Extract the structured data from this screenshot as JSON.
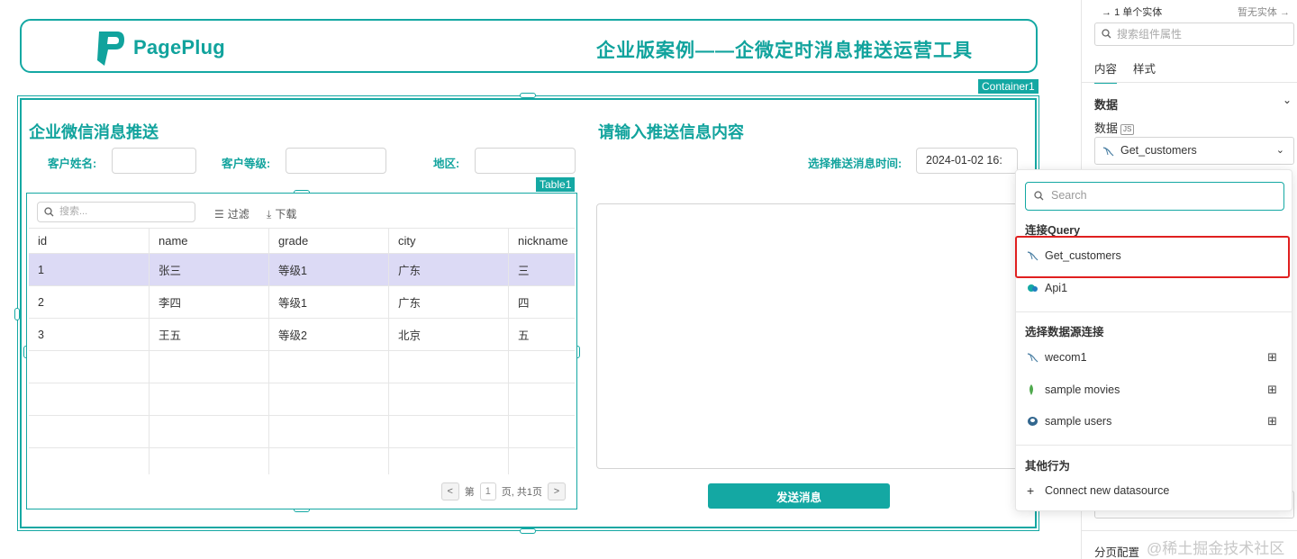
{
  "header": {
    "logo_text": "PagePlug",
    "title": "企业版案例——企微定时消息推送运营工具"
  },
  "container_tag": "Container1",
  "left_section": {
    "title": "企业微信消息推送",
    "labels": {
      "name": "客户姓名:",
      "grade": "客户等级:",
      "region": "地区:"
    }
  },
  "table": {
    "tag": "Table1",
    "search_placeholder": "搜索...",
    "filter_label": "过滤",
    "download_label": "下载",
    "columns": [
      "id",
      "name",
      "grade",
      "city",
      "nickname"
    ],
    "rows": [
      [
        "1",
        "张三",
        "等级1",
        "广东",
        "三"
      ],
      [
        "2",
        "李四",
        "等级1",
        "广东",
        "四"
      ],
      [
        "3",
        "王五",
        "等级2",
        "北京",
        "五"
      ]
    ],
    "selected_row": 0,
    "pager": {
      "page_prefix": "第",
      "page": "1",
      "page_suffix": "页, 共1页"
    }
  },
  "right_section": {
    "title": "请输入推送信息内容",
    "time_label": "选择推送消息时间:",
    "time_value": "2024-01-02 16:",
    "send_label": "发送消息"
  },
  "panel": {
    "entity_count": "1 单个实体",
    "no_entity": "暂无实体",
    "search_placeholder": "搜索组件属性",
    "tabs": [
      "内容",
      "样式"
    ],
    "section": "数据",
    "data_label": "数据",
    "js_badge": "JS",
    "selected_source": "Get_customers",
    "bottom_label": "分页配置"
  },
  "dropdown": {
    "search_placeholder": "Search",
    "query_heading": "连接Query",
    "queries": [
      {
        "label": "Get_customers",
        "icon": "mysql-icon"
      },
      {
        "label": "Api1",
        "icon": "api-icon"
      }
    ],
    "datasource_heading": "选择数据源连接",
    "datasources": [
      {
        "label": "wecom1",
        "icon": "mysql-icon"
      },
      {
        "label": "sample movies",
        "icon": "mongodb-icon"
      },
      {
        "label": "sample users",
        "icon": "postgres-icon"
      }
    ],
    "other_heading": "其他行为",
    "connect_new": "Connect new datasource"
  },
  "watermark": "@稀土掘金技术社区",
  "colors": {
    "accent": "#14a8a3",
    "selected_row": "#dcdaf5",
    "highlight": "#e02020"
  }
}
